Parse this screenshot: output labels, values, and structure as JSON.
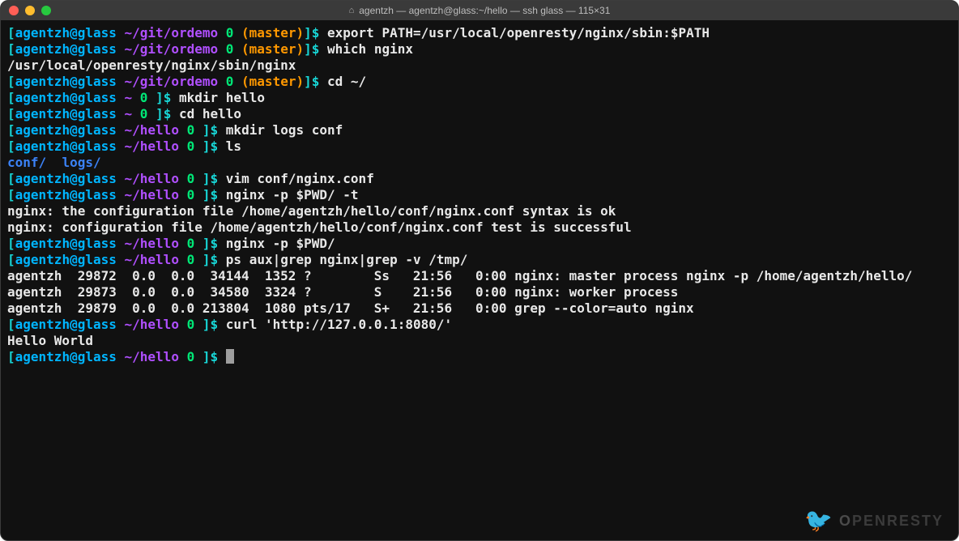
{
  "window": {
    "title": "agentzh — agentzh@glass:~/hello — ssh glass — 115×31"
  },
  "prompt1": {
    "lb": "[",
    "uh": "agentzh@glass",
    "sp": " ",
    "path": "~/git/ordemo",
    "zero": "0",
    "br": "(master)",
    "rb": "]",
    "sig": "$"
  },
  "prompt2": {
    "lb": "[",
    "uh": "agentzh@glass",
    "sp": " ",
    "path": "~",
    "zero": "0",
    "rb": "]",
    "sig": "$"
  },
  "prompt3": {
    "lb": "[",
    "uh": "agentzh@glass",
    "sp": " ",
    "path": "~/hello",
    "zero": "0",
    "rb": "]",
    "sig": "$"
  },
  "cmds": {
    "c1": "export PATH=/usr/local/openresty/nginx/sbin:$PATH",
    "c2": "which nginx",
    "c3": "cd ~/",
    "c4": "mkdir hello",
    "c5": "cd hello",
    "c6": "mkdir logs conf",
    "c7": "ls",
    "c8": "vim conf/nginx.conf",
    "c9": "nginx -p $PWD/ -t",
    "c10": "nginx -p $PWD/",
    "c11": "ps aux|grep nginx|grep -v /tmp/",
    "c12": "curl 'http://127.0.0.1:8080/'"
  },
  "out": {
    "o2": "/usr/local/openresty/nginx/sbin/nginx",
    "ls_conf": "conf/",
    "ls_logs": "logs/",
    "t1": "nginx: the configuration file /home/agentzh/hello/conf/nginx.conf syntax is ok",
    "t2": "nginx: configuration file /home/agentzh/hello/conf/nginx.conf test is successful",
    "ps1": "agentzh  29872  0.0  0.0  34144  1352 ?        Ss   21:56   0:00 nginx: master process nginx -p /home/agentzh/hello/",
    "ps2": "agentzh  29873  0.0  0.0  34580  3324 ?        S    21:56   0:00 nginx: worker process",
    "ps3": "agentzh  29879  0.0  0.0 213804  1080 pts/17   S+   21:56   0:00 grep --color=auto nginx",
    "curl": "Hello World"
  },
  "watermark": {
    "brand_strong": "O",
    "brand_rest": "PENRESTY"
  }
}
